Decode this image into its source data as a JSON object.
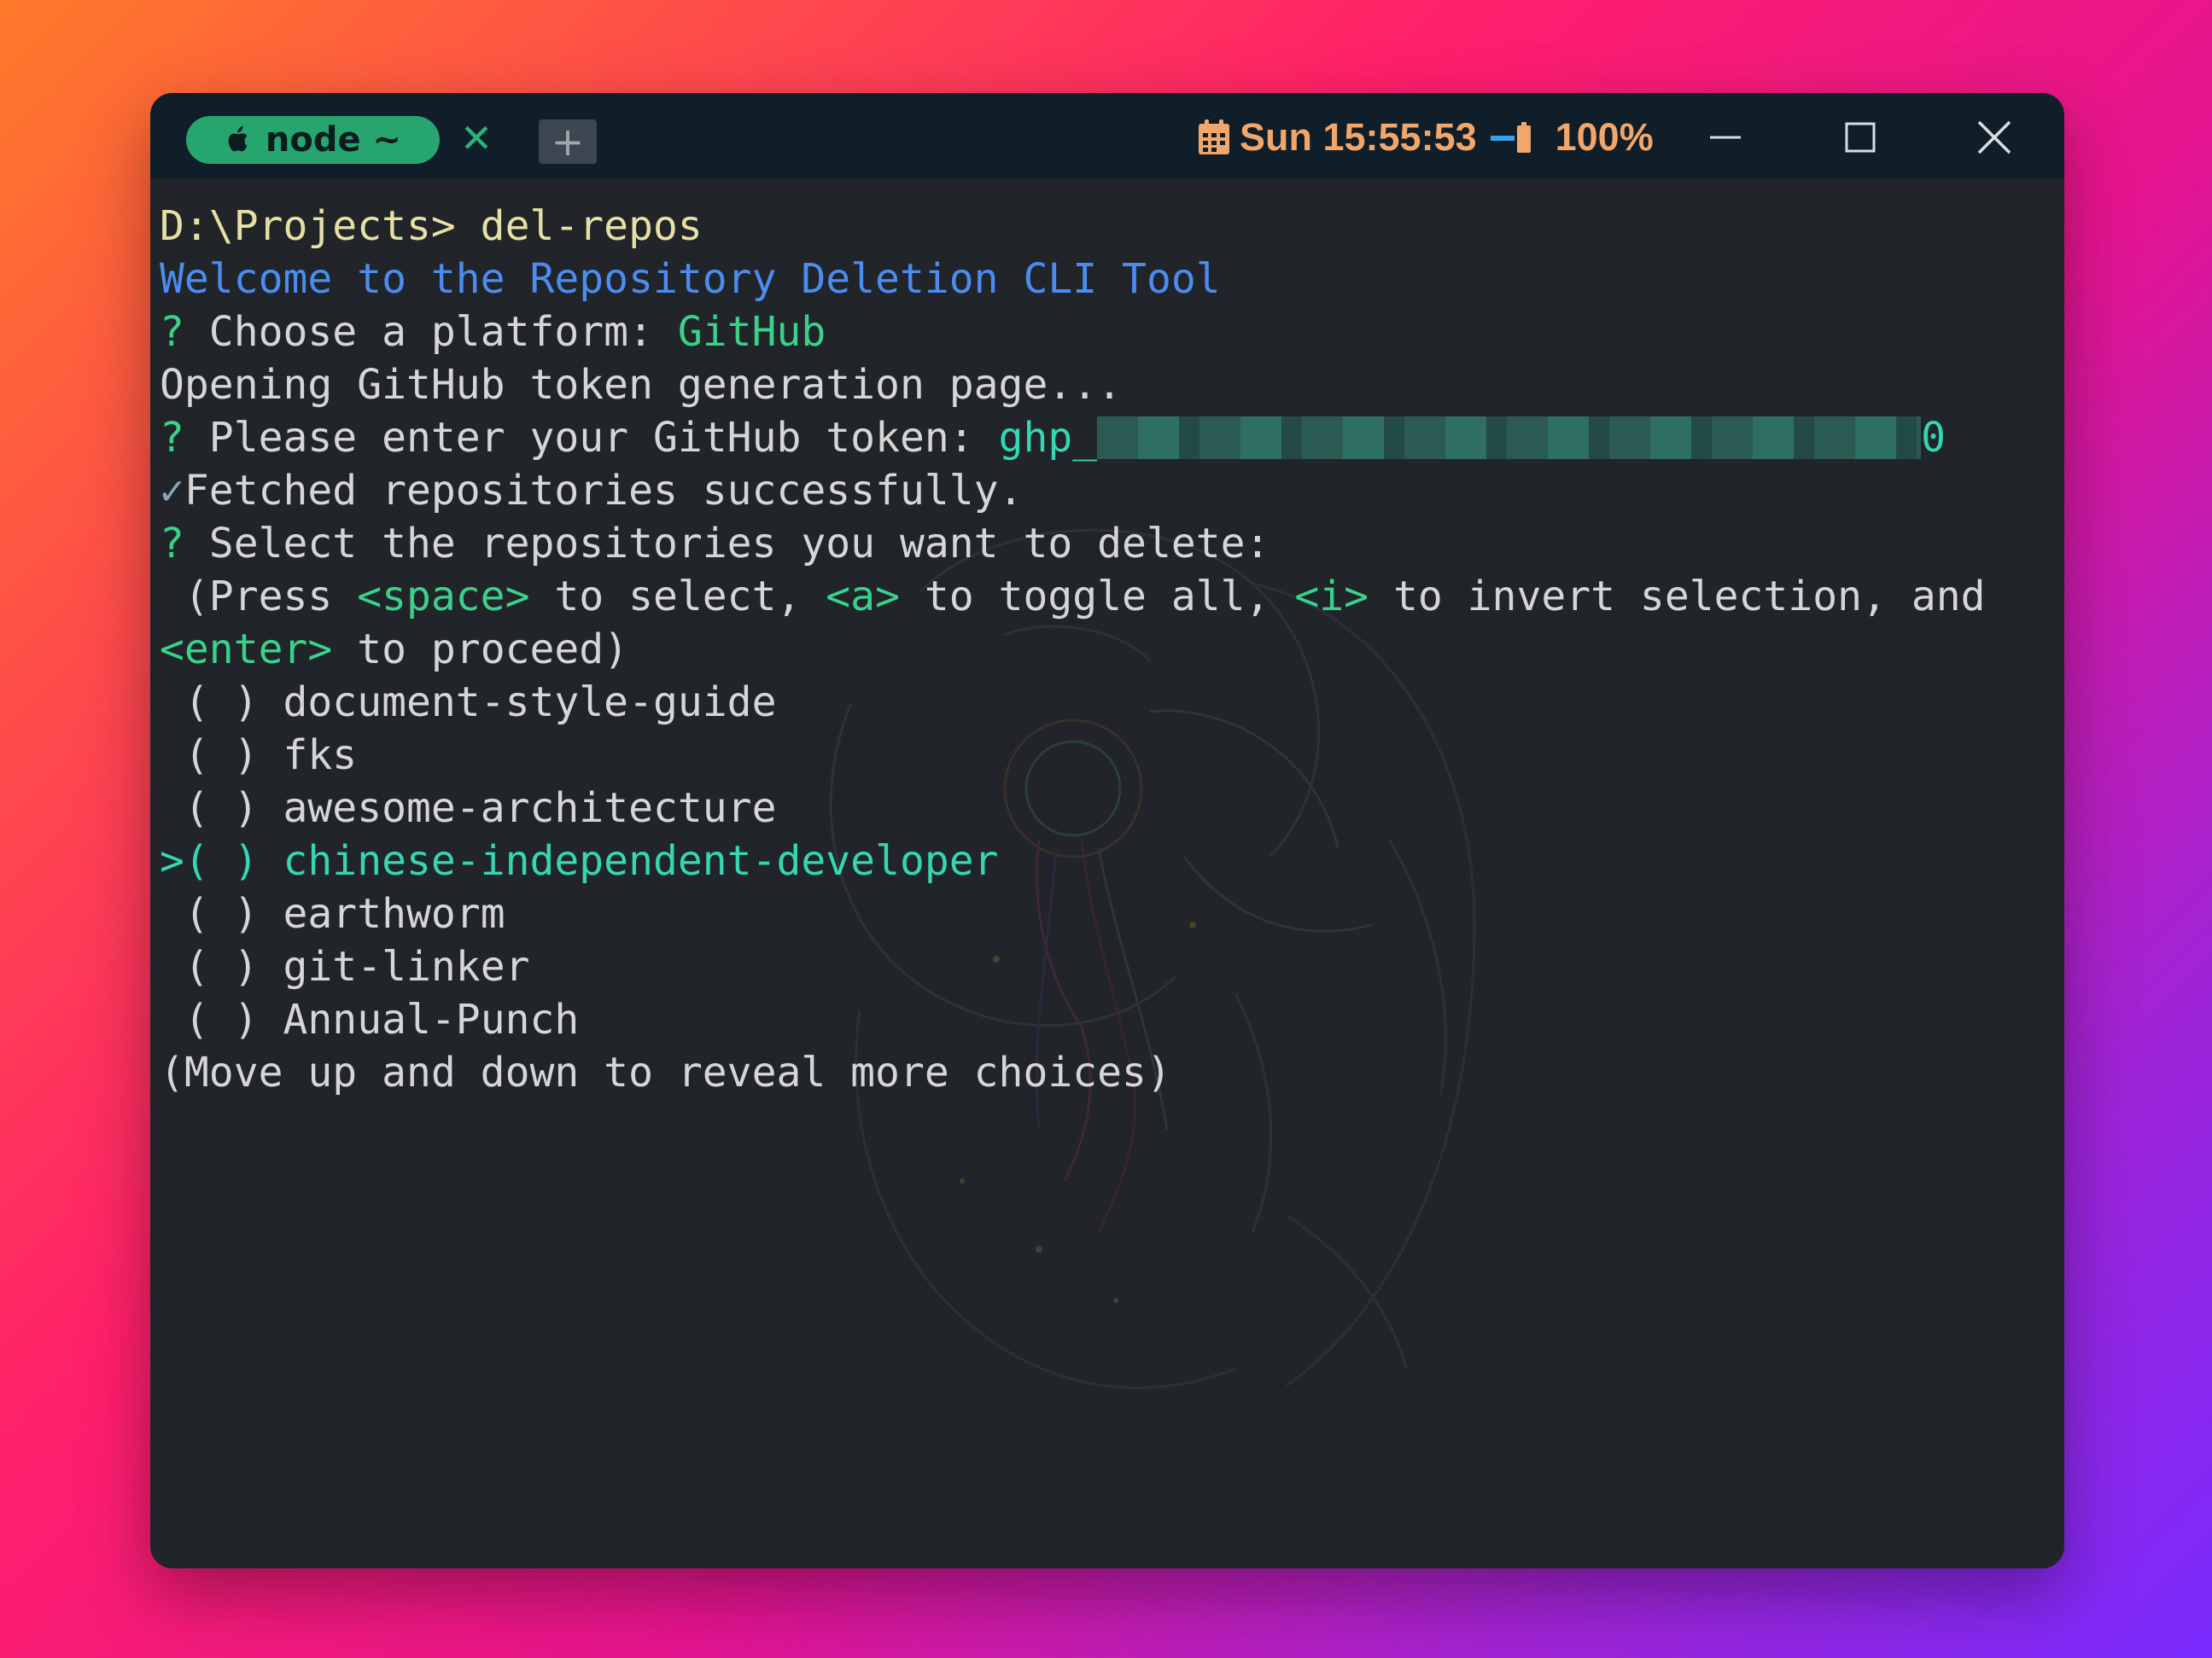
{
  "titlebar": {
    "tab_label": "node ~",
    "tab_icon": "apple-icon",
    "tab_close": "✕",
    "new_tab": "+",
    "clock": "Sun 15:55:53",
    "battery": "100%",
    "colors": {
      "tab": "#27a56e",
      "status_text": "#f2a66a",
      "titlebar": "#0f1e28"
    }
  },
  "terminal": {
    "prompt_path": "D:\\Projects>",
    "command": " del-repos",
    "welcome": "Welcome to the Repository Deletion CLI Tool",
    "q_mark": "?",
    "platform_question": " Choose a platform: ",
    "platform_answer": "GitHub",
    "opening": "Opening GitHub token generation page...",
    "token_question": " Please enter your GitHub token: ",
    "token_prefix": "ghp_",
    "token_suffix": "0",
    "check_mark": "✓",
    "fetched": "Fetched repositories successfully.",
    "select_question": " Select the repositories you want to delete:",
    "hint_line1": {
      "a": " (Press ",
      "space": "<space>",
      "b": " to select, ",
      "akey": "<a>",
      "c": " to toggle all, ",
      "ikey": "<i>",
      "d": " to invert selection, and"
    },
    "hint_line2": {
      "enter": "<enter>",
      "e": " to proceed)"
    },
    "repos": [
      {
        "prefix": " ( ) ",
        "name": "document-style-guide",
        "active": false
      },
      {
        "prefix": " ( ) ",
        "name": "fks",
        "active": false
      },
      {
        "prefix": " ( ) ",
        "name": "awesome-architecture",
        "active": false
      },
      {
        "prefix": ">( ) ",
        "name": "chinese-independent-developer",
        "active": true
      },
      {
        "prefix": " ( ) ",
        "name": "earthworm",
        "active": false
      },
      {
        "prefix": " ( ) ",
        "name": "git-linker",
        "active": false
      },
      {
        "prefix": " ( ) ",
        "name": "Annual-Punch",
        "active": false
      }
    ],
    "more": "(Move up and down to reveal more choices)",
    "colors": {
      "background": "#212428",
      "welcome": "#4a8cf0",
      "accent": "#3ad28a",
      "prompt": "#e6e0a6"
    }
  }
}
